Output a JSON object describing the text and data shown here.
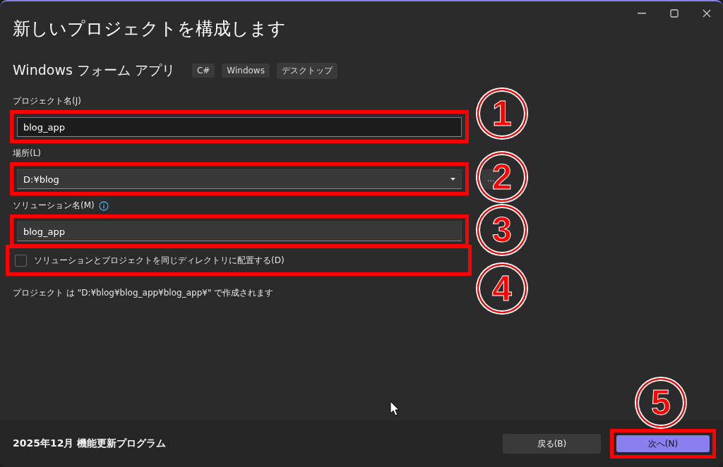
{
  "window": {
    "title": "新しいプロジェクトを構成します",
    "controls": [
      {
        "kind": "minimize"
      },
      {
        "kind": "maximize"
      },
      {
        "kind": "close"
      }
    ]
  },
  "template": {
    "name": "Windows フォーム アプリ",
    "tags": [
      "C#",
      "Windows",
      "デスクトップ"
    ]
  },
  "project_name": {
    "label": "プロジェクト名(J)",
    "value": "blog_app",
    "highlighted": true
  },
  "location": {
    "label": "場所(L)",
    "value": "D:¥blog",
    "highlighted": true,
    "browse_button": "..."
  },
  "solution_name": {
    "label": "ソリューション名(M)",
    "value": "blog_app",
    "highlighted": true
  },
  "same_directory": {
    "label": "ソリューションとプロジェクトを同じディレクトリに配置する(D)",
    "checked": false,
    "highlighted": true
  },
  "path_note": "プロジェクト は \"D:¥blog¥blog_app¥blog_app¥\" で作成されます",
  "annotations": [
    {
      "number": "1"
    },
    {
      "number": "2"
    },
    {
      "number": "3"
    },
    {
      "number": "4"
    },
    {
      "number": "5"
    }
  ],
  "footer": {
    "update_text": "2025年12月 機能更新プログラム",
    "buttons": [
      {
        "label": "戻る(B)",
        "primary": false,
        "highlighted": false
      },
      {
        "label": "次へ(N)",
        "primary": true,
        "highlighted": true
      }
    ]
  }
}
